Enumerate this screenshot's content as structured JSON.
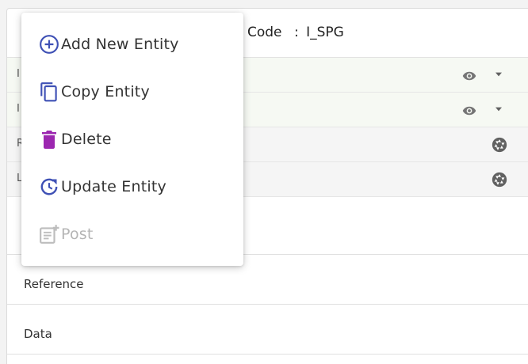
{
  "header": {
    "code_label": "Code",
    "code_sep": ":",
    "code_value": "I_SPG"
  },
  "rows": [
    {
      "stub": "I",
      "icons": [
        "eye-icon",
        "caret-down-icon"
      ]
    },
    {
      "stub": "I",
      "icons": [
        "eye-icon",
        "caret-down-icon"
      ]
    },
    {
      "stub": "R",
      "icons": [
        "aperture-icon"
      ]
    },
    {
      "stub": "L",
      "icons": [
        "aperture-icon"
      ]
    }
  ],
  "sections": [
    {
      "label": ""
    },
    {
      "label": "Reference"
    },
    {
      "label": "Data"
    }
  ],
  "menu": {
    "items": [
      {
        "label": "Add New Entity",
        "icon": "add-circle-icon",
        "enabled": true
      },
      {
        "label": "Copy Entity",
        "icon": "copy-icon",
        "enabled": true
      },
      {
        "label": "Delete",
        "icon": "trash-icon",
        "enabled": true
      },
      {
        "label": "Update Entity",
        "icon": "update-icon",
        "enabled": true
      },
      {
        "label": "Post",
        "icon": "post-icon",
        "enabled": false
      }
    ]
  },
  "colors": {
    "primary": "#3f51b5",
    "delete": "#9c27b0",
    "disabled": "#bdbdbd",
    "icon_gray": "#757575"
  }
}
